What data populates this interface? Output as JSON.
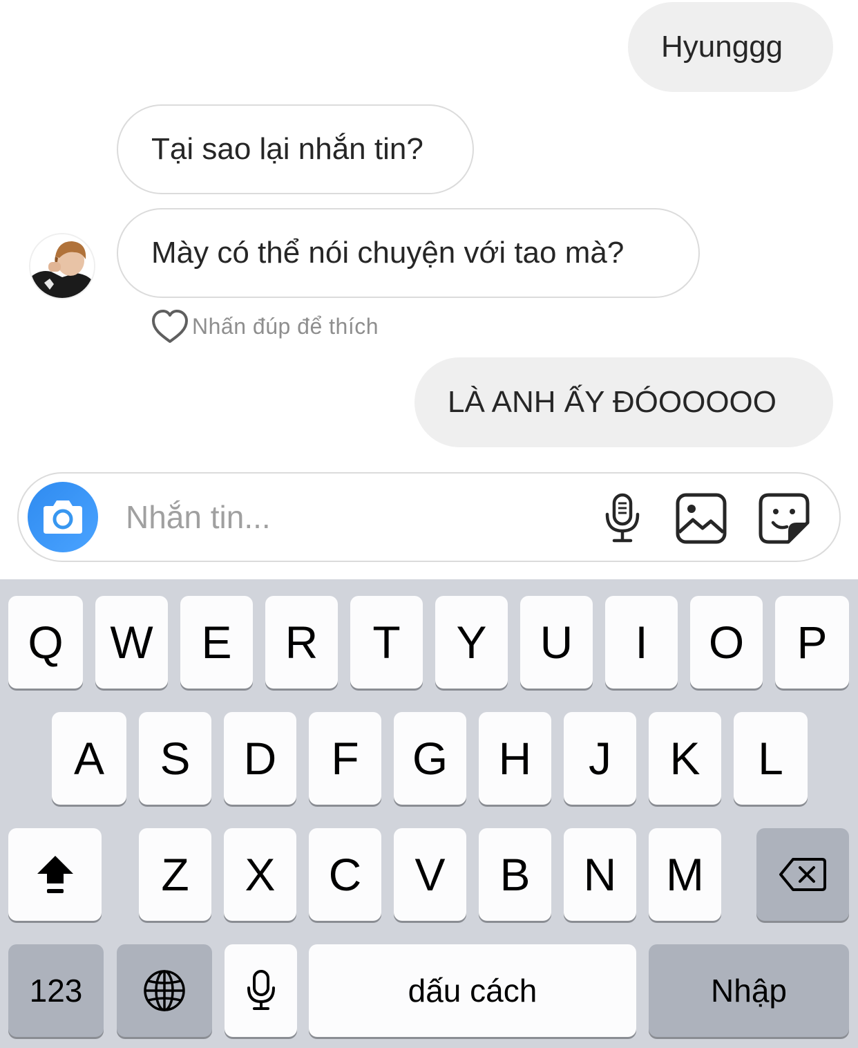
{
  "chat": {
    "messages": [
      {
        "id": "m1",
        "direction": "sent",
        "text": "Hyunggg"
      },
      {
        "id": "m2",
        "direction": "received",
        "text": "Tại sao lại nhắn tin?"
      },
      {
        "id": "m3",
        "direction": "received",
        "text": "Mày có thể nói chuyện với tao mà?"
      },
      {
        "id": "m4",
        "direction": "sent",
        "text": "LÀ ANH ẤY ĐÓOOOOO"
      }
    ],
    "like_hint": "Nhấn đúp để thích"
  },
  "composer": {
    "placeholder": "Nhắn tin...",
    "value": "",
    "icons": [
      "camera-icon",
      "microphone-icon",
      "gallery-icon",
      "sticker-icon"
    ],
    "camera_button_color": "#3897f0"
  },
  "keyboard": {
    "row1": [
      "Q",
      "W",
      "E",
      "R",
      "T",
      "Y",
      "U",
      "I",
      "O",
      "P"
    ],
    "row2": [
      "A",
      "S",
      "D",
      "F",
      "G",
      "H",
      "J",
      "K",
      "L"
    ],
    "row3": [
      "Z",
      "X",
      "C",
      "V",
      "B",
      "N",
      "M"
    ],
    "numbers_label": "123",
    "space_label": "dấu cách",
    "return_label": "Nhập",
    "icons": [
      "shift-icon",
      "backspace-icon",
      "globe-icon",
      "dictation-icon"
    ]
  }
}
